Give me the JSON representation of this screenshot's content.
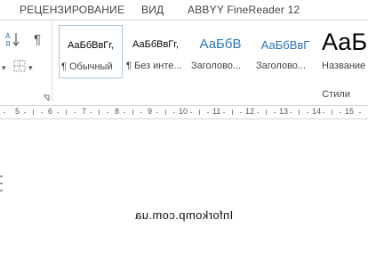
{
  "menu_tabs": [
    "РЕЦЕНЗИРОВАНИЕ",
    "ВИД",
    "ABBYY FineReader 12"
  ],
  "paragraph_icon": "¶",
  "styles": [
    {
      "sample": "АаБбВвГг,",
      "label": "¶ Обычный",
      "selected": true
    },
    {
      "sample": "АаБбВвГг,",
      "label": "¶ Без инте..."
    },
    {
      "sample": "АаБбВ",
      "label": "Заголово..."
    },
    {
      "sample": "АаБбВвГ",
      "label": "Заголово..."
    },
    {
      "sample": "АаБ",
      "label": "Название"
    }
  ],
  "styles_group_label": "Стили",
  "ruler_numbers": [
    "5",
    "6",
    "7",
    "8",
    "9",
    "10",
    "11",
    "12",
    "13",
    "14",
    "15"
  ],
  "document": {
    "mirrored_text": "Inforkomp.com.ua"
  },
  "colors": {
    "heading_blue": "#2e74b5",
    "selected_border": "#a9c3dd"
  }
}
